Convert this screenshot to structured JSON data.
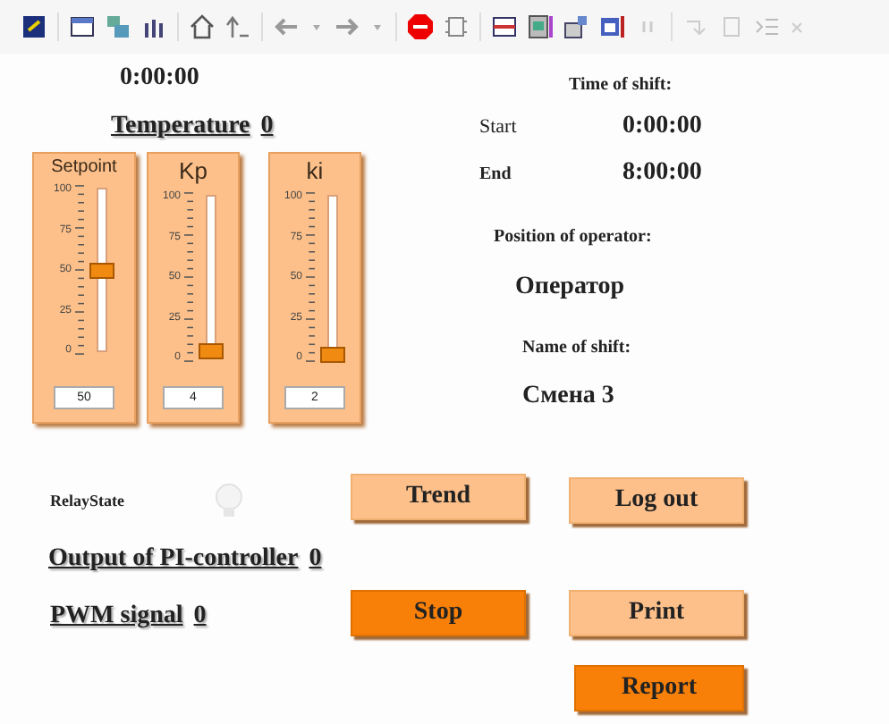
{
  "clock": "0:00:00",
  "temperature": {
    "label": "Temperature",
    "value": "0"
  },
  "sliders": [
    {
      "label": "Setpoint",
      "scale": [
        "100",
        "75",
        "50",
        "25",
        "0"
      ],
      "level": 0.5,
      "value": "50"
    },
    {
      "label": "Kp",
      "scale": [
        "100",
        "75",
        "50",
        "25",
        "0"
      ],
      "level": 0.04,
      "value": "4"
    },
    {
      "label": "ki",
      "scale": [
        "100",
        "75",
        "50",
        "25",
        "0"
      ],
      "level": 0.02,
      "value": "2"
    }
  ],
  "shift": {
    "title": "Time of shift:",
    "start_label": "Start",
    "start": "0:00:00",
    "end_label": "End",
    "end": "8:00:00",
    "position_title": "Position of operator:",
    "position": "Оператор",
    "name_title": "Name of shift:",
    "name": "Смена 3"
  },
  "relay": {
    "label": "RelayState",
    "on": false
  },
  "outputs": [
    {
      "label": "Output of PI-controller",
      "value": "0"
    },
    {
      "label": "PWM signal",
      "value": "0"
    }
  ],
  "buttons": [
    {
      "label": "Trend",
      "kind": "normal"
    },
    {
      "label": "Log out",
      "kind": "normal"
    },
    {
      "label": "Stop",
      "kind": "accent"
    },
    {
      "label": "Print",
      "kind": "normal"
    },
    {
      "label": "Report",
      "kind": "accent"
    }
  ]
}
